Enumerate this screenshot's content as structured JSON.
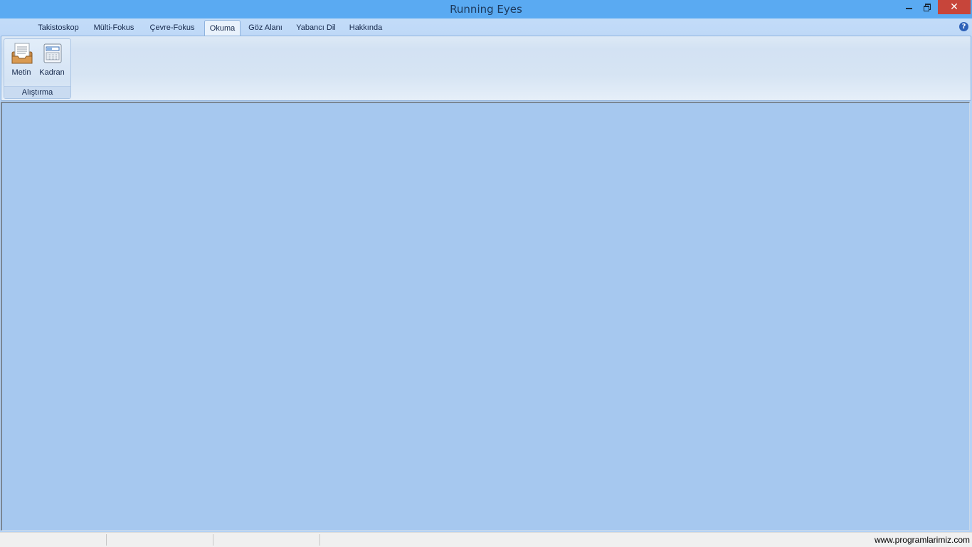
{
  "window": {
    "title": "Running Eyes"
  },
  "tabs": [
    {
      "label": "Takistoskop",
      "active": false
    },
    {
      "label": "Mülti-Fokus",
      "active": false
    },
    {
      "label": "Çevre-Fokus",
      "active": false
    },
    {
      "label": "Okuma",
      "active": true
    },
    {
      "label": "Göz Alanı",
      "active": false
    },
    {
      "label": "Yabancı Dil",
      "active": false
    },
    {
      "label": "Hakkında",
      "active": false
    }
  ],
  "ribbon": {
    "group_caption": "Alıştırma",
    "buttons": [
      {
        "label": "Metin",
        "icon": "document-icon"
      },
      {
        "label": "Kadran",
        "icon": "dial-window-icon"
      }
    ]
  },
  "statusbar": {
    "text": "www.programlarimiz.com"
  },
  "colors": {
    "titlebar": "#5aaaf2",
    "close_button": "#c7453a",
    "client_area": "#a6c8ef",
    "tabs_background": "#c3dcf8"
  }
}
